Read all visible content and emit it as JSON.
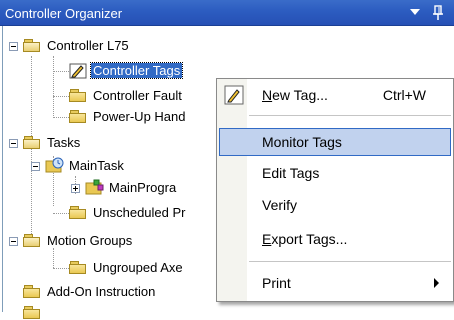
{
  "window": {
    "title": "Controller Organizer"
  },
  "tree": {
    "controller": "Controller L75",
    "controller_tags": "Controller Tags",
    "controller_fault": "Controller Fault",
    "powerup_handler": "Power-Up Hand",
    "tasks": "Tasks",
    "main_task": "MainTask",
    "main_program": "MainProgra",
    "unscheduled": "Unscheduled Pr",
    "motion_groups": "Motion Groups",
    "ungrouped_axes": "Ungrouped Axe",
    "addon_instructions": "Add-On Instruction"
  },
  "context_menu": {
    "new_tag": {
      "label_u": "N",
      "label_rest": "ew Tag...",
      "shortcut": "Ctrl+W"
    },
    "monitor_tags": "Monitor Tags",
    "edit_tags": "Edit Tags",
    "verify": "Verify",
    "export_tags": {
      "label_u": "E",
      "label_rest": "xport Tags..."
    },
    "print": "Print"
  },
  "colors": {
    "titlebar": "#2c5cc0",
    "selection": "#316ac5",
    "menu_highlight": "#c1d2ee"
  }
}
